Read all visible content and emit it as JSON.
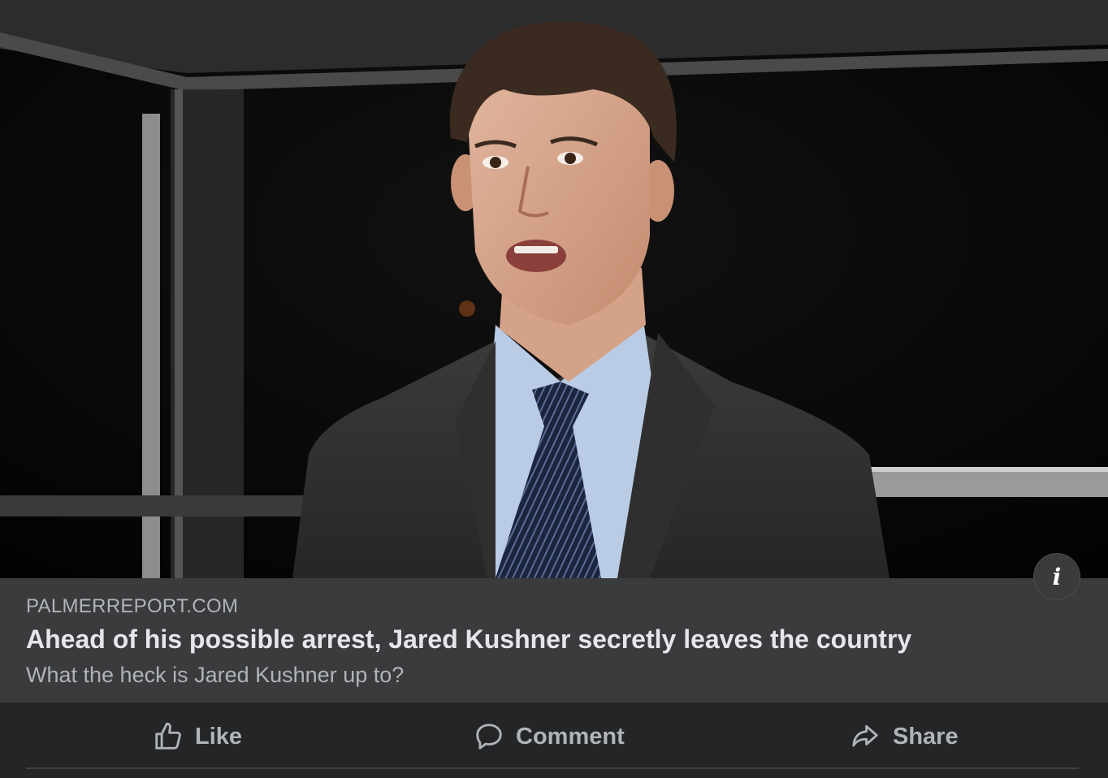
{
  "post": {
    "image_alt": "Man in dark suit, light blue shirt and navy striped tie speaking at night",
    "info_icon": "info-icon",
    "link": {
      "domain": "PALMERREPORT.COM",
      "title": "Ahead of his possible arrest, Jared Kushner secretly leaves the country",
      "subtitle": "What the heck is Jared Kushner up to?"
    },
    "actions": {
      "like_label": "Like",
      "like_icon": "thumbs-up-icon",
      "comment_label": "Comment",
      "comment_icon": "speech-bubble-icon",
      "share_label": "Share",
      "share_icon": "share-arrow-icon"
    }
  },
  "colors": {
    "card_bg": "#242526",
    "preview_bg": "#3a3b3c",
    "primary_text": "#e4e6eb",
    "secondary_text": "#b0b3b8"
  }
}
